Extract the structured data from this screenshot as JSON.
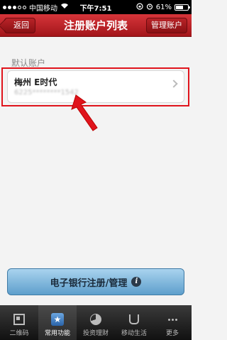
{
  "status_bar": {
    "carrier": "中国移动",
    "time": "下午7:51",
    "battery": "61%",
    "battery_level": 0.61
  },
  "nav": {
    "back_label": "返回",
    "title": "注册账户列表",
    "manage_label": "管理账户"
  },
  "section_label": "默认账户",
  "account": {
    "name": "梅州 E时代",
    "number": "6225********1542"
  },
  "ebank_button": "电子银行注册/管理",
  "tabs": [
    {
      "label": "二维码",
      "icon": "qr-code-icon",
      "active": false
    },
    {
      "label": "常用功能",
      "icon": "star-icon",
      "active": true
    },
    {
      "label": "投资理财",
      "icon": "pie-chart-icon",
      "active": false
    },
    {
      "label": "移动生活",
      "icon": "cup-icon",
      "active": false
    },
    {
      "label": "更多",
      "icon": "more-icon",
      "active": false
    }
  ]
}
